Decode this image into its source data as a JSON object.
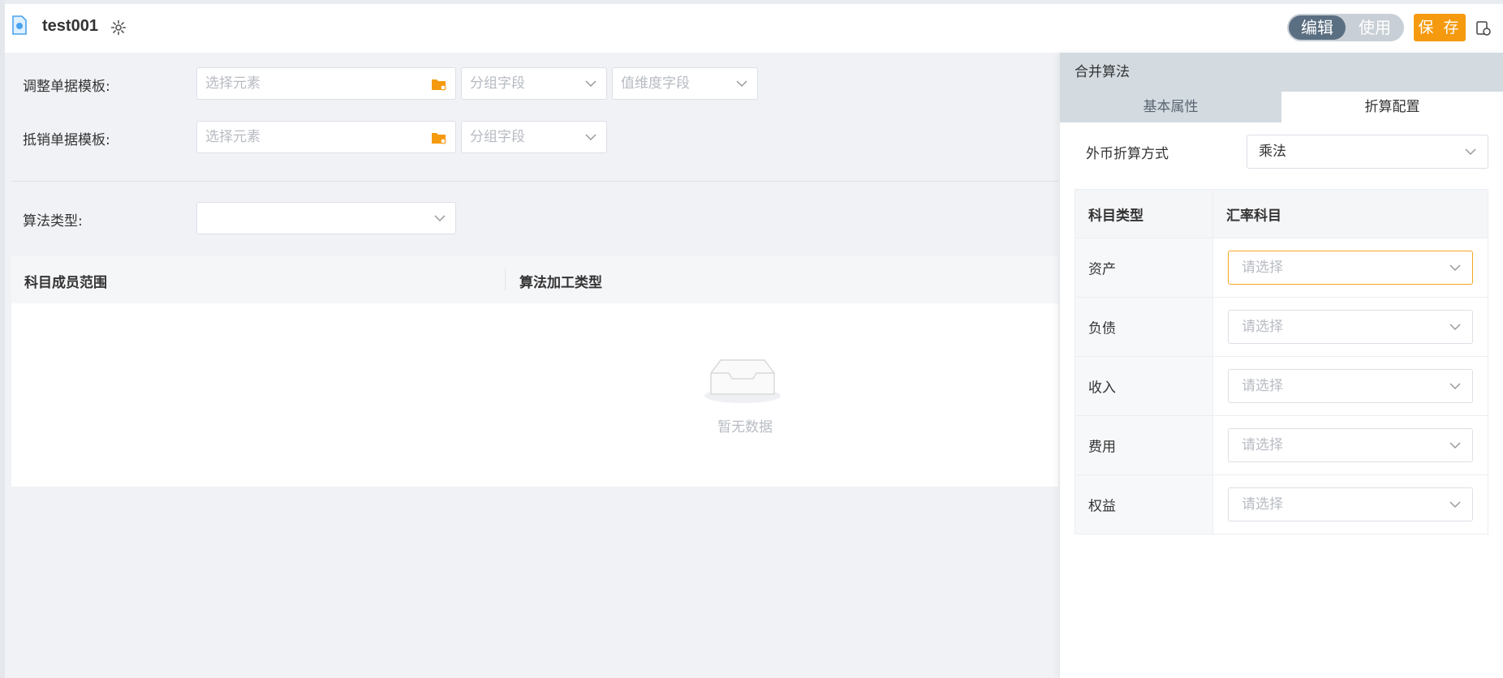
{
  "header": {
    "title": "test001",
    "mode_edit": "编辑",
    "mode_use": "使用",
    "save_label": "保 存"
  },
  "form": {
    "adjust_label": "调整单据模板:",
    "offset_label": "抵销单据模板:",
    "algo_type_label": "算法类型:",
    "select_element_placeholder": "选择元素",
    "group_field_placeholder": "分组字段",
    "value_dim_placeholder": "值维度字段",
    "algo_type_value": ""
  },
  "table": {
    "columns": [
      "科目成员范围",
      "算法加工类型"
    ],
    "empty_text": "暂无数据"
  },
  "drawer": {
    "title": "合并算法",
    "tabs": [
      "基本属性",
      "折算配置"
    ],
    "active_tab": "折算配置",
    "conversion_label": "外币折算方式",
    "conversion_value": "乘法",
    "rate_table": {
      "headers": [
        "科目类型",
        "汇率科目"
      ],
      "rows": [
        {
          "type": "资产",
          "placeholder": "请选择"
        },
        {
          "type": "负债",
          "placeholder": "请选择"
        },
        {
          "type": "收入",
          "placeholder": "请选择"
        },
        {
          "type": "费用",
          "placeholder": "请选择"
        },
        {
          "type": "权益",
          "placeholder": "请选择"
        }
      ]
    }
  },
  "colors": {
    "accent": "#f59a0e",
    "toggle_active": "#5b6f82",
    "drawer_header": "#d3dbe1"
  }
}
